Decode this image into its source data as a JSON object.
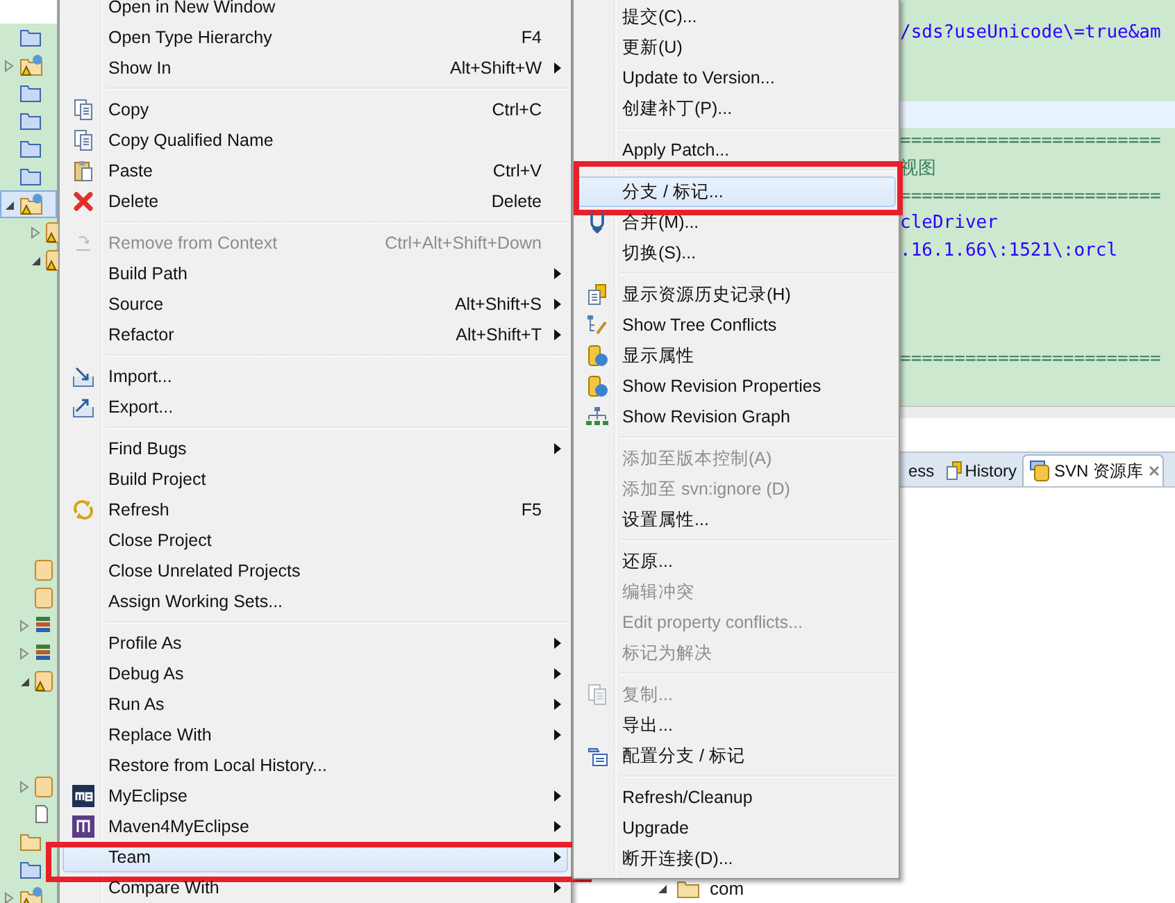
{
  "tree": [
    {
      "kind": "folder"
    },
    {
      "kind": "linked-project",
      "expanded": false
    },
    {
      "kind": "folder"
    },
    {
      "kind": "folder"
    },
    {
      "kind": "folder"
    },
    {
      "kind": "folder"
    },
    {
      "kind": "web-project",
      "expanded": true,
      "selected": true,
      "children": [
        {
          "kind": "warn-package",
          "expanded": false
        },
        {
          "kind": "warn-package",
          "expanded": true
        }
      ]
    }
  ],
  "tree_lower": [
    {
      "kind": "source-folder"
    },
    {
      "kind": "source-folder"
    },
    {
      "kind": "library",
      "expanded": false
    },
    {
      "kind": "library",
      "expanded": false
    },
    {
      "kind": "warn-package",
      "expanded": true
    }
  ],
  "tree_bottom": [
    {
      "kind": "source-folder",
      "expanded": false
    },
    {
      "kind": "file"
    },
    {
      "kind": "open-folder"
    },
    {
      "kind": "folder"
    },
    {
      "kind": "linked-project",
      "expanded": false
    }
  ],
  "editor": {
    "lines": [
      {
        "kind": "value",
        "text": "/sds?useUnicode\\=true&am"
      },
      {
        "kind": "blank"
      },
      {
        "kind": "blank"
      },
      {
        "kind": "current"
      },
      {
        "kind": "comment",
        "text": "========================"
      },
      {
        "kind": "comment",
        "text": "视图"
      },
      {
        "kind": "comment",
        "text": "========================"
      },
      {
        "kind": "value",
        "text": "cleDriver"
      },
      {
        "kind": "value",
        "text": ".16.1.66\\:1521\\:orcl"
      },
      {
        "kind": "blank"
      },
      {
        "kind": "blank"
      },
      {
        "kind": "blank"
      },
      {
        "kind": "comment",
        "text": "========================"
      }
    ]
  },
  "bottom_panel": {
    "tabs": [
      {
        "label": "ess",
        "selected": false
      },
      {
        "label": "History",
        "selected": false
      },
      {
        "label": "SVN 资源库",
        "selected": true
      }
    ],
    "tree": [
      {
        "label": "com",
        "expanded": true
      }
    ]
  },
  "context_menu": {
    "groups": [
      [
        {
          "label": "Open in New Window",
          "submenu": false,
          "disabled": false,
          "selected": false
        },
        {
          "label": "Open Type Hierarchy",
          "shortcut": "F4",
          "submenu": false,
          "disabled": false,
          "selected": false
        },
        {
          "label": "Show In",
          "shortcut": "Alt+Shift+W",
          "submenu": true,
          "disabled": false,
          "selected": false
        }
      ],
      [
        {
          "label": "Copy",
          "shortcut": "Ctrl+C",
          "submenu": false,
          "disabled": false,
          "selected": false
        },
        {
          "label": "Copy Qualified Name",
          "submenu": false,
          "disabled": false,
          "selected": false
        },
        {
          "label": "Paste",
          "shortcut": "Ctrl+V",
          "submenu": false,
          "disabled": false,
          "selected": false
        },
        {
          "label": "Delete",
          "shortcut": "Delete",
          "submenu": false,
          "disabled": false,
          "selected": false
        }
      ],
      [
        {
          "label": "Remove from Context",
          "shortcut": "Ctrl+Alt+Shift+Down",
          "submenu": false,
          "disabled": true,
          "selected": false
        },
        {
          "label": "Build Path",
          "submenu": true,
          "disabled": false,
          "selected": false
        },
        {
          "label": "Source",
          "shortcut": "Alt+Shift+S",
          "submenu": true,
          "disabled": false,
          "selected": false
        },
        {
          "label": "Refactor",
          "shortcut": "Alt+Shift+T",
          "submenu": true,
          "disabled": false,
          "selected": false
        }
      ],
      [
        {
          "label": "Import...",
          "submenu": false,
          "disabled": false,
          "selected": false
        },
        {
          "label": "Export...",
          "submenu": false,
          "disabled": false,
          "selected": false
        }
      ],
      [
        {
          "label": "Find Bugs",
          "submenu": true,
          "disabled": false,
          "selected": false
        },
        {
          "label": "Build Project",
          "submenu": false,
          "disabled": false,
          "selected": false
        },
        {
          "label": "Refresh",
          "shortcut": "F5",
          "submenu": false,
          "disabled": false,
          "selected": false
        },
        {
          "label": "Close Project",
          "submenu": false,
          "disabled": false,
          "selected": false
        },
        {
          "label": "Close Unrelated Projects",
          "submenu": false,
          "disabled": false,
          "selected": false
        },
        {
          "label": "Assign Working Sets...",
          "submenu": false,
          "disabled": false,
          "selected": false
        }
      ],
      [
        {
          "label": "Profile As",
          "submenu": true,
          "disabled": false,
          "selected": false
        },
        {
          "label": "Debug As",
          "submenu": true,
          "disabled": false,
          "selected": false
        },
        {
          "label": "Run As",
          "submenu": true,
          "disabled": false,
          "selected": false
        },
        {
          "label": "Replace With",
          "submenu": true,
          "disabled": false,
          "selected": false
        },
        {
          "label": "Restore from Local History...",
          "submenu": false,
          "disabled": false,
          "selected": false
        },
        {
          "label": "MyEclipse",
          "submenu": true,
          "disabled": false,
          "selected": false
        },
        {
          "label": "Maven4MyEclipse",
          "submenu": true,
          "disabled": false,
          "selected": false
        },
        {
          "label": "Team",
          "submenu": true,
          "disabled": false,
          "selected": true,
          "annotated": true
        },
        {
          "label": "Compare With",
          "submenu": true,
          "disabled": false,
          "selected": false
        }
      ]
    ]
  },
  "team_submenu": {
    "groups": [
      [
        {
          "label": "提交(C)...",
          "disabled": false,
          "selected": false
        },
        {
          "label": "更新(U)",
          "disabled": false,
          "selected": false
        },
        {
          "label": "Update to Version...",
          "disabled": false,
          "selected": false
        },
        {
          "label": "创建补丁(P)...",
          "disabled": false,
          "selected": false
        }
      ],
      [
        {
          "label": "Apply Patch...",
          "disabled": false,
          "selected": false
        }
      ],
      [
        {
          "label": "分支 / 标记...",
          "disabled": false,
          "selected": true,
          "annotated": true
        },
        {
          "label": "合并(M)...",
          "disabled": false,
          "selected": false
        },
        {
          "label": "切换(S)...",
          "disabled": false,
          "selected": false
        }
      ],
      [
        {
          "label": "显示资源历史记录(H)",
          "disabled": false,
          "selected": false
        },
        {
          "label": "Show Tree Conflicts",
          "disabled": false,
          "selected": false
        },
        {
          "label": "显示属性",
          "disabled": false,
          "selected": false
        },
        {
          "label": "Show Revision Properties",
          "disabled": false,
          "selected": false
        },
        {
          "label": "Show Revision Graph",
          "disabled": false,
          "selected": false
        }
      ],
      [
        {
          "label": "添加至版本控制(A)",
          "disabled": true,
          "selected": false
        },
        {
          "label": "添加至 svn:ignore (D)",
          "disabled": true,
          "selected": false
        },
        {
          "label": "设置属性...",
          "disabled": false,
          "selected": false
        }
      ],
      [
        {
          "label": "还原...",
          "disabled": false,
          "selected": false
        },
        {
          "label": "编辑冲突",
          "disabled": true,
          "selected": false
        },
        {
          "label": "Edit property conflicts...",
          "disabled": true,
          "selected": false
        },
        {
          "label": "标记为解决",
          "disabled": true,
          "selected": false
        }
      ],
      [
        {
          "label": "复制...",
          "disabled": true,
          "selected": false
        },
        {
          "label": "导出...",
          "disabled": false,
          "selected": false
        },
        {
          "label": "配置分支 / 标记",
          "disabled": false,
          "selected": false
        }
      ],
      [
        {
          "label": "Refresh/Cleanup",
          "disabled": false,
          "selected": false
        },
        {
          "label": "Upgrade",
          "disabled": false,
          "selected": false
        },
        {
          "label": "断开连接(D)...",
          "disabled": false,
          "selected": false
        }
      ]
    ]
  }
}
